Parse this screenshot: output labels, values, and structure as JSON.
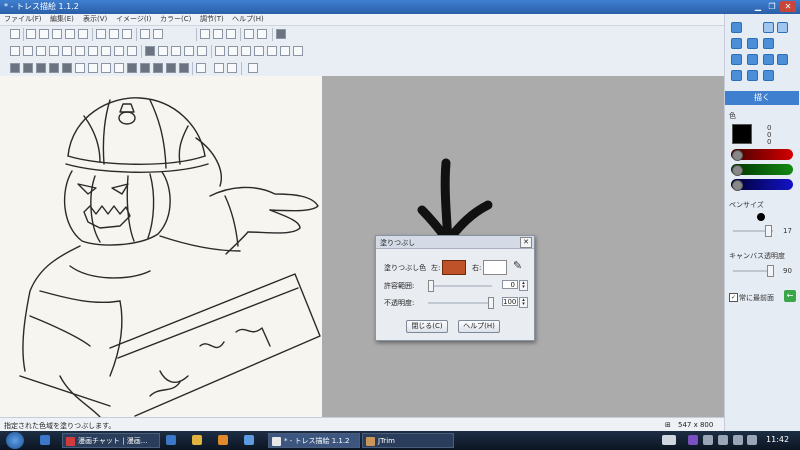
{
  "window": {
    "title": "* - トレス描絵 1.1.2"
  },
  "menu": [
    {
      "label": "ファイル(F)"
    },
    {
      "label": "編集(E)"
    },
    {
      "label": "表示(V)"
    },
    {
      "label": "イメージ(I)"
    },
    {
      "label": "カラー(C)"
    },
    {
      "label": "調节(T)"
    },
    {
      "label": "ヘルプ(H)"
    }
  ],
  "panel": {
    "draw_button": "描く",
    "color_label": "色",
    "rgb": [
      "0",
      "0",
      "0"
    ],
    "pen_size_label": "ペンサイズ",
    "pen_size_value": "17",
    "canvas_opacity_label": "キャンバス透明度",
    "canvas_opacity_value": "90",
    "always_on_top_label": "常に最前面",
    "colors": {
      "accent": "#3f7fd0",
      "red": "#d40000",
      "green": "#138a13",
      "blue": "#1313c8"
    }
  },
  "dialog": {
    "title": "塗りつぶし",
    "fill_color_label": "塗りつぶし色",
    "left_label": "左:",
    "right_label": "右:",
    "left_color": "#c0522a",
    "tolerance_label": "許容範囲:",
    "tolerance_value": "0",
    "opacity_label": "不透明度:",
    "opacity_value": "100",
    "close_button": "閉じる(C)",
    "help_button": "ヘルプ(H)"
  },
  "status": {
    "message": "指定された色域を塗りつぶします。",
    "dimensions": "547 x 800"
  },
  "taskbar": {
    "tasks": [
      {
        "label": "漫画チャット | 漫画..."
      },
      {
        "label": "* - トレス描絵 1.1.2"
      },
      {
        "label": "JTrim"
      }
    ],
    "clock": "11:42"
  }
}
